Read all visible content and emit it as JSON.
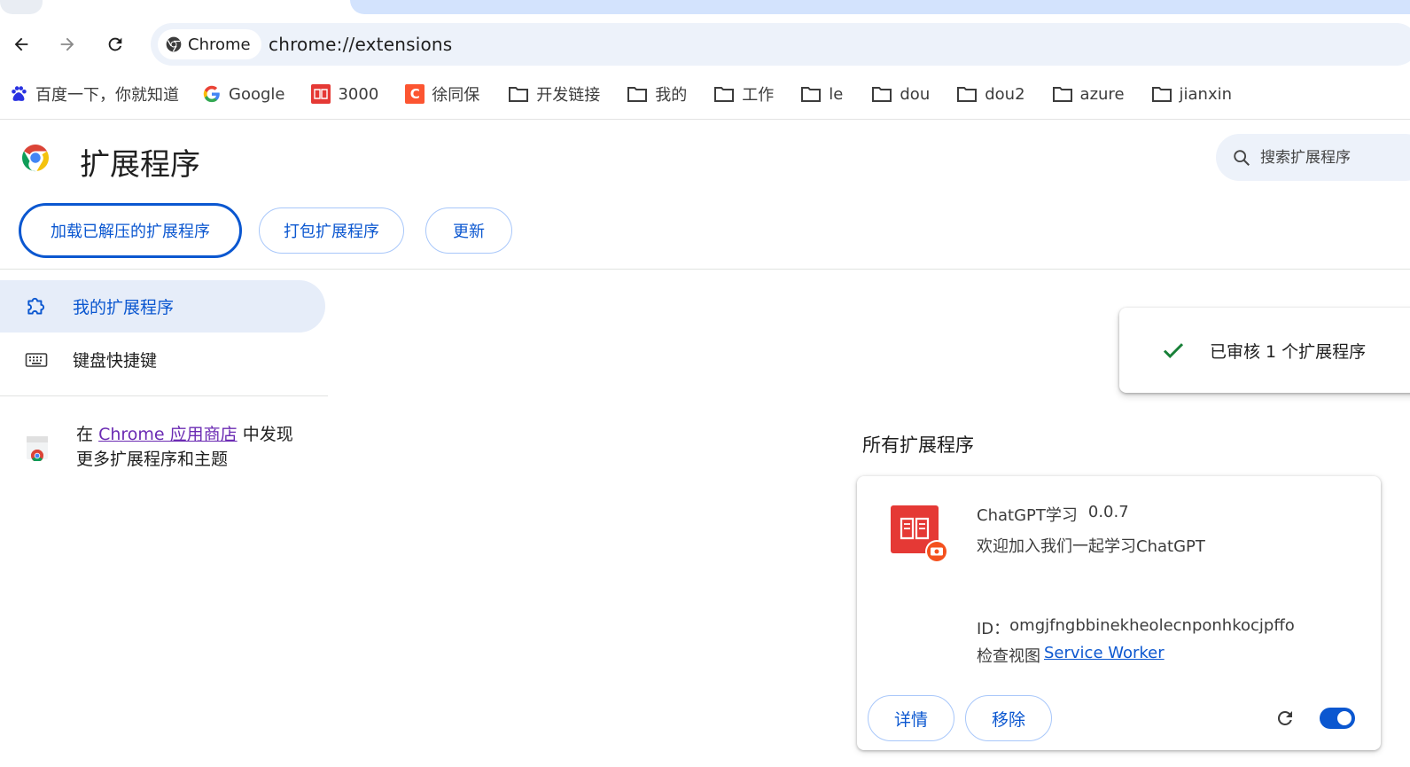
{
  "browser": {
    "site_chip_label": "Chrome",
    "url": "chrome://extensions"
  },
  "bookmarks": [
    {
      "label": "百度一下，你就知道",
      "icon": "baidu-icon"
    },
    {
      "label": "Google",
      "icon": "google-icon"
    },
    {
      "label": "3000",
      "icon": "book-icon"
    },
    {
      "label": "徐同保",
      "icon": "csdn-icon"
    },
    {
      "label": "开发链接",
      "icon": "folder-icon"
    },
    {
      "label": "我的",
      "icon": "folder-icon"
    },
    {
      "label": "工作",
      "icon": "folder-icon"
    },
    {
      "label": "le",
      "icon": "folder-icon"
    },
    {
      "label": "dou",
      "icon": "folder-icon"
    },
    {
      "label": "dou2",
      "icon": "folder-icon"
    },
    {
      "label": "azure",
      "icon": "folder-icon"
    },
    {
      "label": "jianxin",
      "icon": "folder-icon"
    }
  ],
  "page": {
    "title": "扩展程序",
    "search_placeholder": "搜索扩展程序"
  },
  "dev_buttons": {
    "load_unpacked": "加载已解压的扩展程序",
    "pack": "打包扩展程序",
    "update": "更新"
  },
  "sidebar": {
    "items": [
      {
        "label": "我的扩展程序",
        "icon": "extension-icon",
        "active": true
      },
      {
        "label": "键盘快捷键",
        "icon": "keyboard-icon",
        "active": false
      }
    ],
    "store_prefix": "在",
    "store_link": "Chrome 应用商店",
    "store_suffix": "中发现",
    "store_line2": "更多扩展程序和主题"
  },
  "toast": {
    "message": "已审核 1 个扩展程序"
  },
  "extensions": {
    "section_title": "所有扩展程序",
    "items": [
      {
        "name": "ChatGPT学习",
        "version": "0.0.7",
        "description": "欢迎加入我们一起学习ChatGPT",
        "id_label": "ID：",
        "id": "omgjfngbbinekheolecnponhkocjpffo",
        "views_label": "检查视图",
        "views_link": "Service Worker",
        "details_label": "详情",
        "remove_label": "移除",
        "enabled": true
      }
    ]
  },
  "colors": {
    "accent": "#0b57d0",
    "active_bg": "#e6edf9",
    "omnibox_bg": "#edf2fa",
    "toast_check": "#188038"
  }
}
